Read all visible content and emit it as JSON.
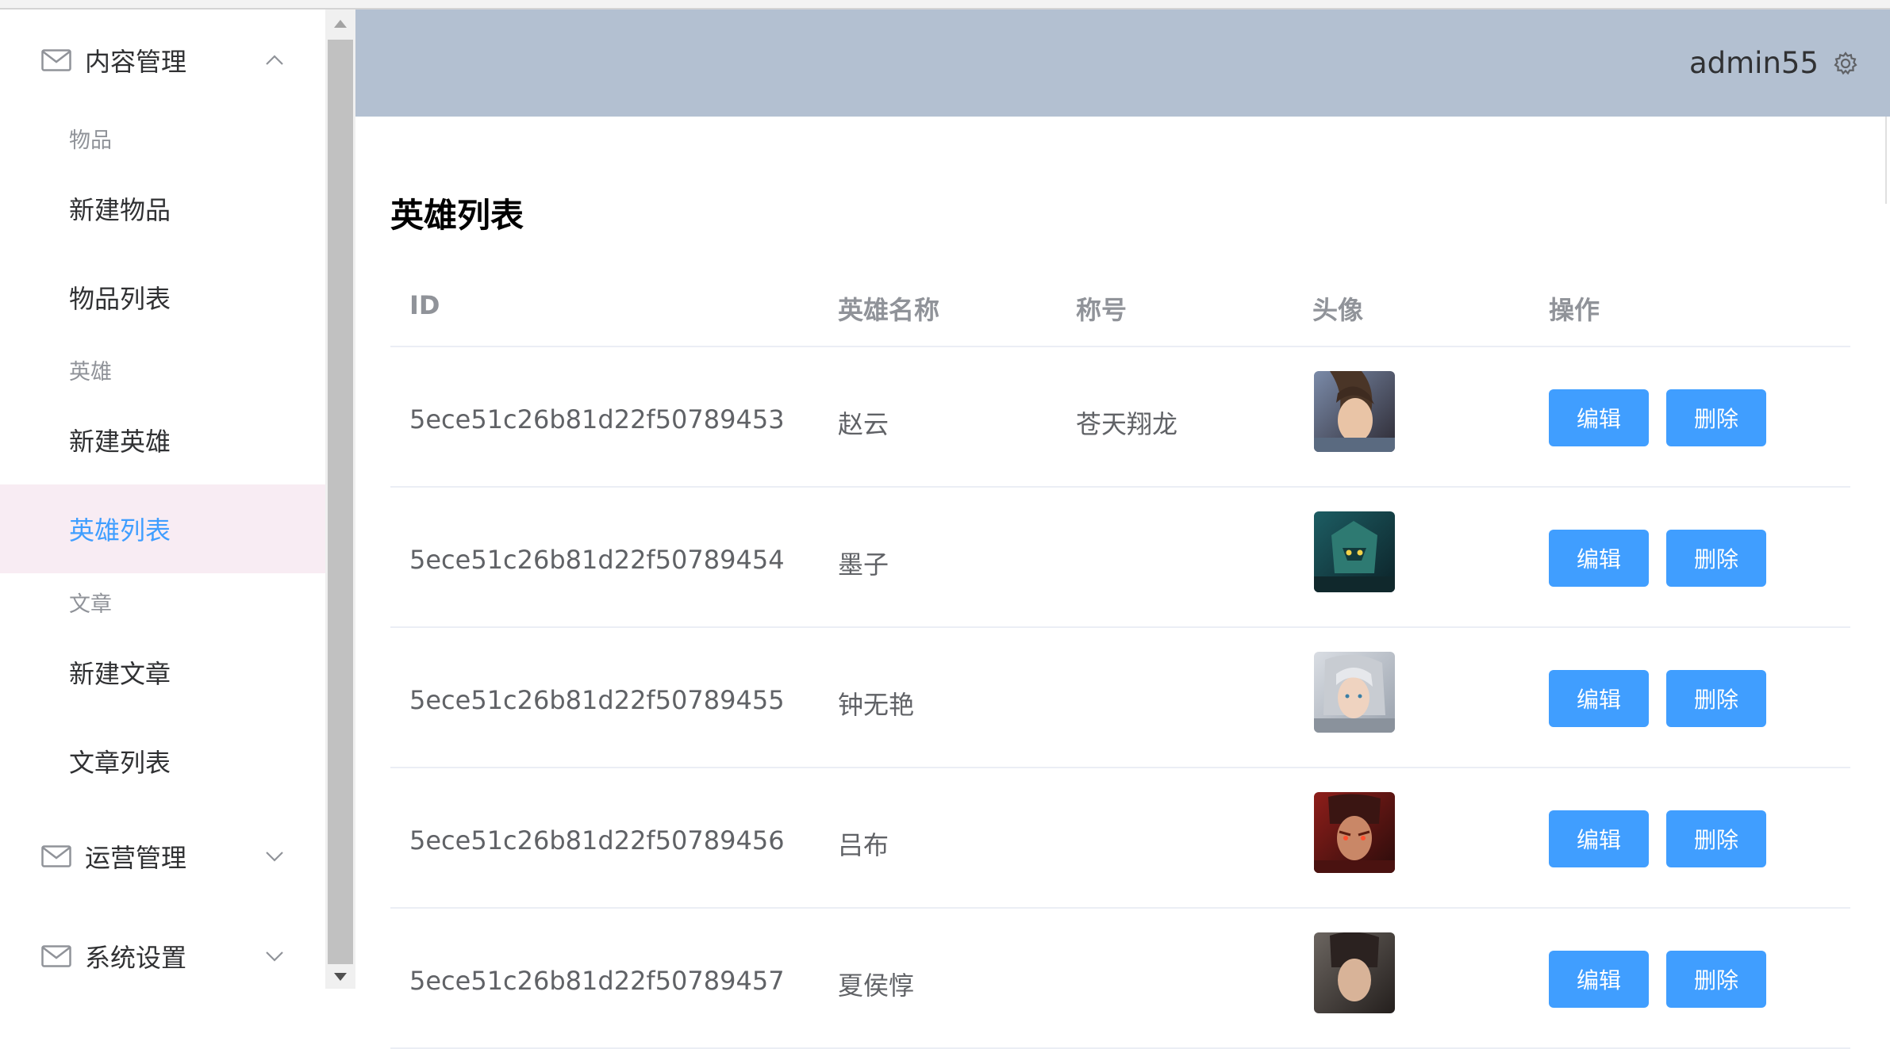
{
  "user": {
    "name": "admin55"
  },
  "sidebar": {
    "menus": [
      {
        "title": "内容管理",
        "expanded": true
      },
      {
        "title": "运营管理",
        "expanded": false
      },
      {
        "title": "系统设置",
        "expanded": false
      }
    ],
    "groups": [
      {
        "label": "物品",
        "items": [
          "新建物品",
          "物品列表"
        ]
      },
      {
        "label": "英雄",
        "items": [
          "新建英雄",
          "英雄列表"
        ]
      },
      {
        "label": "文章",
        "items": [
          "新建文章",
          "文章列表"
        ]
      }
    ],
    "active_item": "英雄列表"
  },
  "page": {
    "title": "英雄列表"
  },
  "table": {
    "headers": [
      "ID",
      "英雄名称",
      "称号",
      "头像",
      "操作"
    ],
    "rows": [
      {
        "id": "5ece51c26b81d22f50789453",
        "name": "赵云",
        "title": "苍天翔龙"
      },
      {
        "id": "5ece51c26b81d22f50789454",
        "name": "墨子",
        "title": ""
      },
      {
        "id": "5ece51c26b81d22f50789455",
        "name": "钟无艳",
        "title": ""
      },
      {
        "id": "5ece51c26b81d22f50789456",
        "name": "吕布",
        "title": ""
      },
      {
        "id": "5ece51c26b81d22f50789457",
        "name": "夏侯惇",
        "title": ""
      }
    ],
    "actions": {
      "edit": "编辑",
      "delete": "删除"
    }
  },
  "colors": {
    "primary": "#409eff",
    "header_bg": "#b3c0d1",
    "active_bg": "#f8ecf3"
  },
  "icons": {
    "menu": "mail-icon",
    "settings": "gear-icon",
    "expanded": "chevron-up-icon",
    "collapsed": "chevron-down-icon"
  }
}
